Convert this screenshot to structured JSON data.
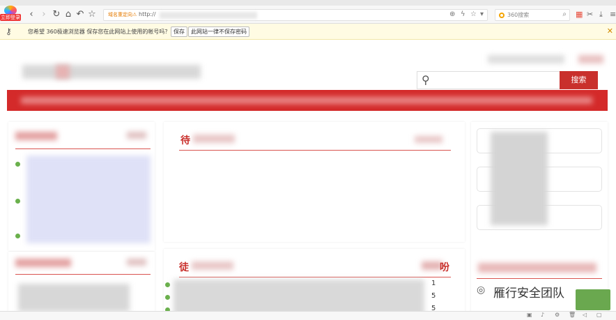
{
  "browser": {
    "login_badge": "立即登录",
    "address_warning": "域名重定向⚠",
    "address_prefix": "http://",
    "search_engine": "360搜索"
  },
  "password_bar": {
    "message": "您希望 360极速浏览器 保存您在此网站上使用的帐号吗？",
    "save_label": "保存",
    "never_label": "此网站一律不保存密码"
  },
  "site": {
    "search_button": "搜索",
    "center_panel_title": "待",
    "lower_center_title": "徒",
    "counts": [
      "1",
      "5",
      "5"
    ],
    "right_tail": "吩"
  },
  "watermark": {
    "text": "雁行安全团队"
  },
  "colors": {
    "brand_red": "#d42a2a",
    "bullet_green": "#6ab04c",
    "password_bar_bg": "#fffbe3"
  }
}
